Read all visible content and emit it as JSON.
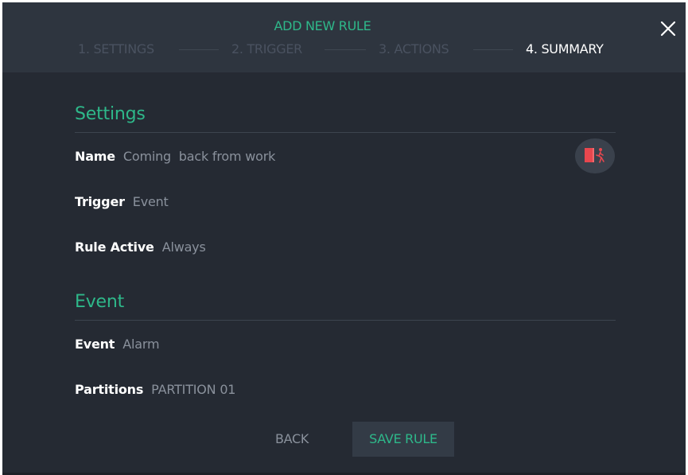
{
  "header": {
    "title": "ADD NEW RULE",
    "close_icon": "close-icon"
  },
  "steps": [
    {
      "label": "1. SETTINGS",
      "active": false
    },
    {
      "label": "2. TRIGGER",
      "active": false
    },
    {
      "label": "3. ACTIONS",
      "active": false
    },
    {
      "label": "4. SUMMARY",
      "active": true
    }
  ],
  "settings": {
    "title": "Settings",
    "name_label": "Name",
    "name_value": "Coming  back from work",
    "trigger_label": "Trigger",
    "trigger_value": "Event",
    "rule_active_label": "Rule Active",
    "rule_active_value": "Always",
    "icon": "door-exit-icon"
  },
  "event": {
    "title": "Event",
    "event_label": "Event",
    "event_value": "Alarm",
    "partitions_label": "Partitions",
    "partitions_value": "PARTITION 01"
  },
  "footer": {
    "back_label": "BACK",
    "save_label": "SAVE RULE"
  },
  "colors": {
    "accent": "#2eb88a",
    "background": "#252a33",
    "header_background": "#2e353f",
    "icon_red": "#e8474e"
  }
}
